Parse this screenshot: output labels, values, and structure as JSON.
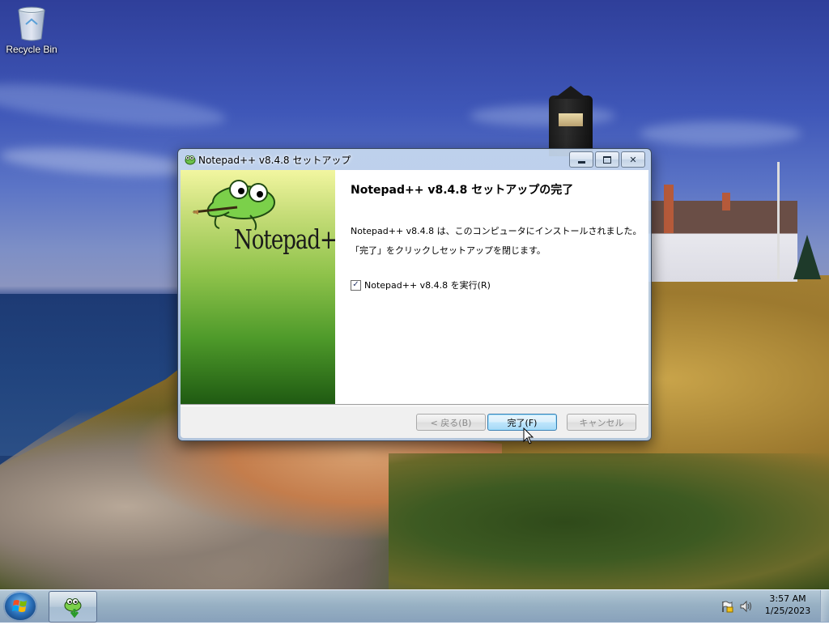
{
  "desktop": {
    "icons": [
      {
        "label": "Recycle Bin"
      }
    ]
  },
  "window": {
    "title": "Notepad++ v8.4.8 セットアップ",
    "heading": "Notepad++ v8.4.8 セットアップの完了",
    "body_lines": [
      "Notepad++ v8.4.8 は、このコンピュータにインストールされました。",
      "「完了」をクリックしセットアップを閉じます。"
    ],
    "run_checkbox": {
      "label": "Notepad++ v8.4.8 を実行(R)",
      "checked": true
    },
    "buttons": {
      "back": "< 戻る(B)",
      "finish": "完了(F)",
      "cancel": "キャンセル"
    },
    "banner_logo_text": "Notepad++"
  },
  "taskbar": {
    "clock_time": "3:57 AM",
    "clock_date": "1/25/2023"
  }
}
